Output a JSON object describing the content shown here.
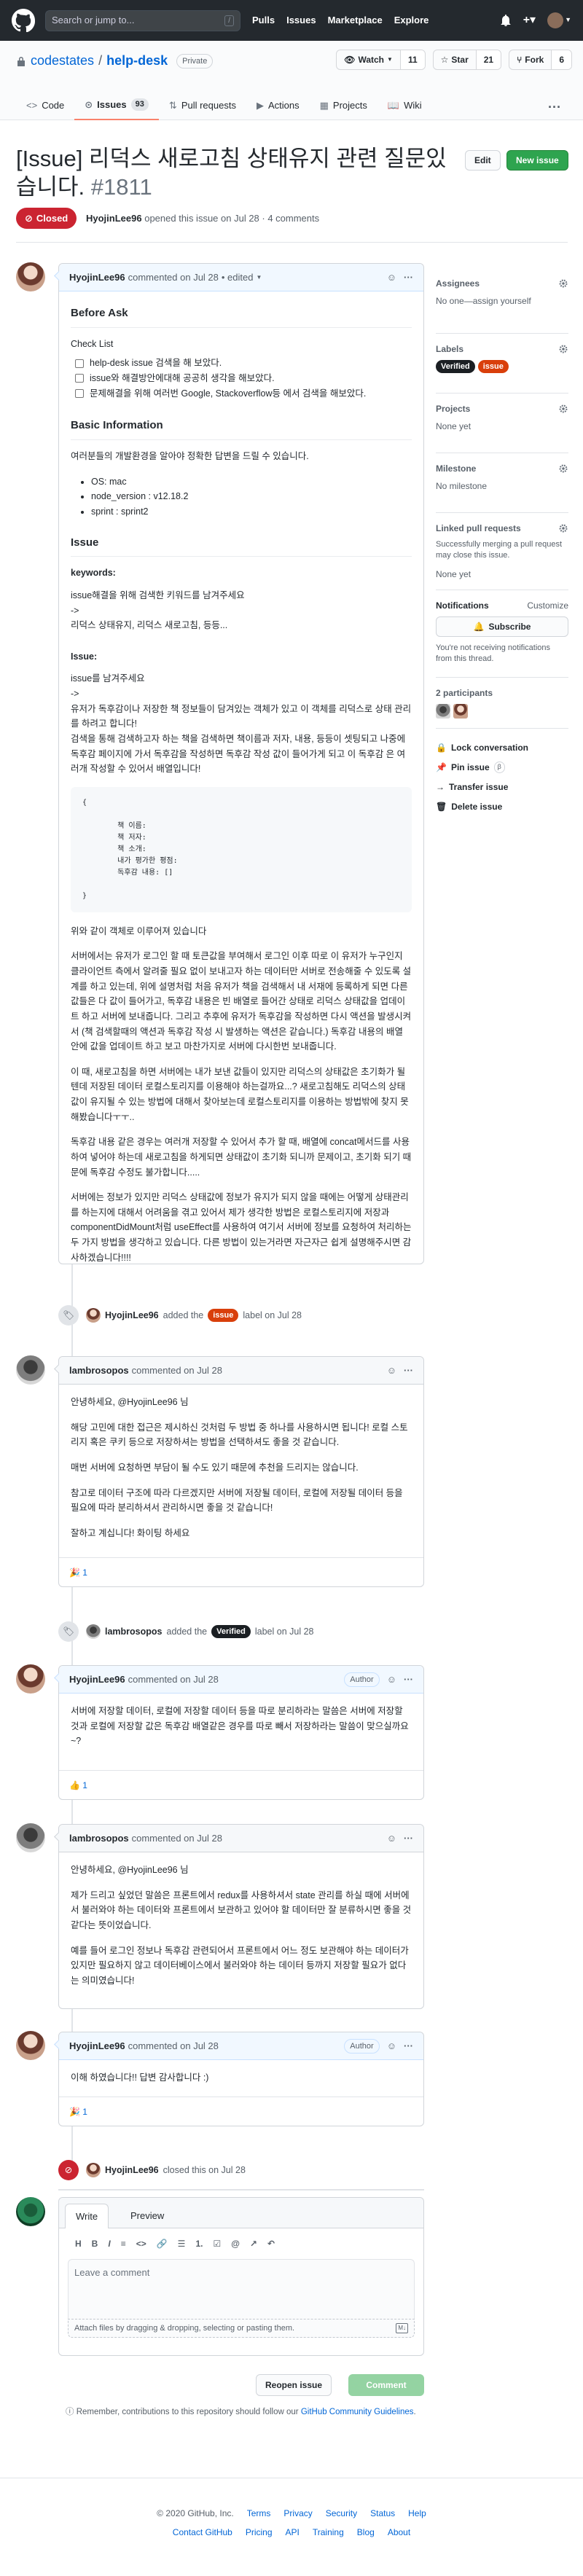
{
  "topbar": {
    "search_placeholder": "Search or jump to...",
    "search_key": "/",
    "nav": [
      "Pulls",
      "Issues",
      "Marketplace",
      "Explore"
    ]
  },
  "repo": {
    "owner": "codestates",
    "name": "help-desk",
    "visibility": "Private",
    "watch": {
      "label": "Watch",
      "count": "11"
    },
    "star": {
      "label": "Star",
      "count": "21"
    },
    "fork": {
      "label": "Fork",
      "count": "6"
    },
    "tabs": [
      {
        "label": "Code"
      },
      {
        "label": "Issues",
        "count": "93"
      },
      {
        "label": "Pull requests"
      },
      {
        "label": "Actions"
      },
      {
        "label": "Projects"
      },
      {
        "label": "Wiki"
      }
    ],
    "tabs_more": "···"
  },
  "issue": {
    "title": "[Issue] 리덕스 새로고침 상태유지 관련 질문있습니다.",
    "number": "#1811",
    "edit": "Edit",
    "new_issue": "New issue",
    "state": "Closed",
    "author": "HyojinLee96",
    "meta_text": "opened this issue on Jul 28 · 4 comments"
  },
  "first_comment": {
    "author": "HyojinLee96",
    "date": "commented on Jul 28",
    "edited": "• edited",
    "before_ask": "Before Ask",
    "checklist_title": "Check List",
    "checklist": [
      "help-desk issue 검색을 해 보았다.",
      "issue와 해결방안에대해 공공히 생각을 해보았다.",
      "문제해결을 위해 여러번 Google, Stackoverflow등 에서 검색을 해보았다."
    ],
    "basic_info": "Basic Information",
    "basic_desc": "여러분들의 개발환경을 알아야 정확한 답변을 드릴 수 있습니다.",
    "env": [
      "OS: mac",
      "node_version : v12.18.2",
      "sprint : sprint2"
    ],
    "issue_heading": "Issue",
    "keywords_title": "keywords:",
    "keywords_lines": [
      "issue해결을 위해 검색한 키워드를 남겨주세요",
      "->",
      "리덕스 상태유지, 리덕스 새로고침, 등등..."
    ],
    "issue_title": "Issue:",
    "issue_lines": [
      "issue를 남겨주세요",
      "->",
      "유저가 독후감이나 저장한 책 정보들이 담겨있는 객체가 있고 이 객체를 리덕스로 상태 관리를 하려고 합니다!",
      "검색을 통해 검색하고자 하는 책을 검색하면 책이름과 저자, 내용, 등등이 셋팅되고 나중에 독후감 페이지에 가서 독후감을 작성하면 독후감 작성 값이 들어가게 되고 이 독후감 은 여러개 작성할 수 있어서 배열입니다!"
    ],
    "code_block": "{\n\n        책 이름:\n        책 저자:\n        책 소개:\n        내가 평가한 평점:\n        독후감 내용: []\n\n}",
    "para1": "위와 같이 객체로 이루어져 있습니다",
    "para2": "서버에서는 유저가 로그인 할 때 토큰값을 부여해서 로그인 이후 따로 이 유저가 누구인지 클라이언트 측에서 알려줄 필요 없이 보내고자 하는 데이터만 서버로 전송해줄 수 있도록 설계를 하고 있는데, 위에 설명처럼 처음 유저가 책을 검색해서 내 서재에 등록하게 되면 다른 값들은 다 값이 들어가고, 독후감 내용은 빈 배열로 들어간 상태로 리덕스 상태값을 업데이트 하고 서버에 보내줍니다. 그리고 추후에 유저가 독후감을 작성하면 다시 액션을 발생시켜서 (책 검색할때의 액션과 독후감 작성 시 발생하는 액션은 같습니다.) 독후감 내용의 배열 안에 값을 업데이트 하고 보고 마찬가지로 서버에 다시한번 보내줍니다.",
    "para3": "이 때, 새로고침을 하면 서버에는 내가 보낸 값들이 있지만 리덕스의 상태값은 초기화가 될텐데 저장된 데이터 로컬스토리지를 이용해야 하는걸까요...? 새로고침해도 리덕스의 상태 값이 유지될 수 있는 방법에 대해서 찾아보는데 로컬스토리지를 이용하는 방법밖에 찾지 못해봤습니다ㅜㅜ..",
    "para4": "독후감 내용 같은 경우는 여러개 저장할 수 있어서 추가 할 때, 배열에 concat메서드를 사용하여 넣어야 하는데 새로고침을 하게되면 상태값이 초기화 되니까 문제이고, 초기화 되기 때문에 독후감 수정도 불가합니다.....",
    "para5": "서버에는 정보가 있지만 리덕스 상태값에 정보가 유지가 되지 않을 때에는 어떻게 상태관리를 하는지에 대해서 어려움을 겪고 있어서 제가 생각한 방법은 로컬스토리지에 저장과 componentDidMount처럼 useEffect를 사용하여 여기서 서버에 정보를 요청하여 처리하는 두 가지 방법을 생각하고 있습니다. 다른 방법이 있는거라면 자근자근 쉽게 설명해주시면 감사하겠습니다!!!!"
  },
  "event_label1": {
    "actor": "HyojinLee96",
    "verb": "added the",
    "label": "issue",
    "label_color": "#d93f0b",
    "suffix": "label on Jul 28"
  },
  "comment2": {
    "author": "lambrosopos",
    "date": "commented on Jul 28",
    "greeting": "안녕하세요, @HyojinLee96 님",
    "p1": "해당 고민에 대한 접근은 제시하신 것처럼 두 방법 중 하나를 사용하시면 됩니다! 로컬 스토리지 혹은 쿠키 등으로 저장하셔는 방법을 선택하셔도 좋을 것 같습니다.",
    "p2": "매번 서버에 요청하면 부담이 될 수도 있기 때문에 추천을 드리지는 않습니다.",
    "p3": "참고로 데이터 구조에 따라 다르겠지만 서버에 저장될 데이터, 로컬에 저장될 데이터 등을 필요에 따라 분리하셔서 관리하시면 좋을 것 같습니다!",
    "p4": "잘하고 계십니다! 화이팅 하세요",
    "reaction": "🎉",
    "reaction_count": "1"
  },
  "event_label2": {
    "actor": "lambrosopos",
    "verb": "added the",
    "label": "Verified",
    "label_color": "#1b1f23",
    "suffix": "label on Jul 28"
  },
  "comment3": {
    "author": "HyojinLee96",
    "date": "commented on Jul 28",
    "badge": "Author",
    "p1": "서버에 저장할 데이터, 로컬에 저장할 데이터 등을 따로 분리하라는 말씀은",
    "p2": "서버에 저장할 데이터, 로컬에 저장할 데이터 등을 따로 분리하라는 말씀은 서버에 저장할 것과 로컬에 저장할 값은 독후감 배열같은 경우를 따로 빼서 저장하라는 말씀이 맞으실까요~?",
    "reaction": "👍",
    "reaction_count": "1"
  },
  "comment4": {
    "author": "lambrosopos",
    "date": "commented on Jul 28",
    "greeting": "안녕하세요, @HyojinLee96 님",
    "p1": "제가 드리고 싶었던 말씀은 프론트에서 redux를 사용하셔서 state 관리를 하실 때에 서버에서 불러와야 하는 데이터와 프론트에서 보관하고 있어야 할 데이터만 잘 분류하시면 좋을 것 같다는 뜻이었습니다.",
    "p2": "예를 들어 로그인 정보나 독후감 관련되어서 프론트에서 어느 정도 보관해야 하는 데이터가 있지만 필요하지 않고 데이터베이스에서 불러와야 하는 데이터 등까지 저장할 필요가 없다는 의미였습니다!"
  },
  "comment5": {
    "author": "HyojinLee96",
    "date": "commented on Jul 28",
    "badge": "Author",
    "p1": "이해 하였습니다!! 답변 감사합니다 :)",
    "reaction": "🎉",
    "reaction_count": "1"
  },
  "event_closed": {
    "actor": "HyojinLee96",
    "text": "closed this on Jul 28"
  },
  "composer": {
    "tab_write": "Write",
    "tab_preview": "Preview",
    "placeholder": "Leave a comment",
    "attach": "Attach files by dragging & dropping, selecting or pasting them.",
    "reopen": "Reopen issue",
    "comment": "Comment",
    "toolbar": [
      "H",
      "B",
      "I",
      "≡",
      "<>",
      "🔗",
      "☰",
      "1.",
      "☑",
      "@",
      "↗",
      "↶"
    ]
  },
  "remember": {
    "text": "Remember, contributions to this repository should follow our",
    "link": "GitHub Community Guidelines",
    "end": "."
  },
  "sidebar": {
    "assignees_title": "Assignees",
    "assignees_value": "No one—assign yourself",
    "labels_title": "Labels",
    "labels": [
      {
        "name": "Verified",
        "color": "#1b1f23"
      },
      {
        "name": "issue",
        "color": "#d93f0b"
      }
    ],
    "projects_title": "Projects",
    "projects_value": "None yet",
    "milestone_title": "Milestone",
    "milestone_value": "No milestone",
    "linked_title": "Linked pull requests",
    "linked_desc": "Successfully merging a pull request may close this issue.",
    "linked_value": "None yet",
    "notifications_title": "Notifications",
    "customize": "Customize",
    "subscribe": "Subscribe",
    "notif_desc": "You're not receiving notifications from this thread.",
    "participants": "2 participants",
    "actions": [
      "Lock conversation",
      "Pin issue",
      "Transfer issue",
      "Delete issue"
    ],
    "pin_badge": "β"
  },
  "footer": {
    "copyright": "© 2020 GitHub, Inc.",
    "row1": [
      "Terms",
      "Privacy",
      "Security",
      "Status",
      "Help"
    ],
    "row2": [
      "Contact GitHub",
      "Pricing",
      "API",
      "Training",
      "Blog",
      "About"
    ]
  }
}
